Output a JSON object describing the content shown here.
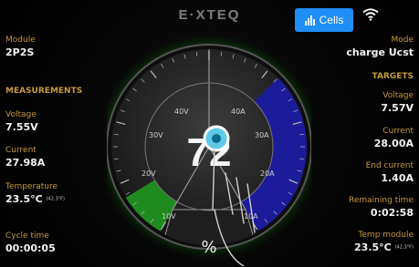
{
  "header": {
    "brand": "E·XTEQ",
    "cells_button_label": "Cells",
    "wifi_icon": "wifi-icon"
  },
  "left": {
    "module_label": "Module",
    "module_value": "2P2S",
    "measurements_label": "MEASUREMENTS",
    "voltage_label": "Voltage",
    "voltage_value": "7.55V",
    "current_label": "Current",
    "current_value": "27.98A",
    "temperature_label": "Temperature",
    "temperature_value": "23.5°C",
    "temperature_sub": "(42.3°F)",
    "cycle_label": "Cycle time",
    "cycle_value": "00:00:05"
  },
  "right": {
    "mode_label": "Mode",
    "mode_value": "charge Ucst",
    "targets_label": "TARGETS",
    "voltage_label": "Voltage",
    "voltage_value": "7.57V",
    "current_label": "Current",
    "current_value": "28.00A",
    "end_current_label": "End current",
    "end_current_value": "1.40A",
    "remaining_label": "Remaining time",
    "remaining_value": "0:02:58",
    "temp_module_label": "Temp module",
    "temp_module_value": "23.5°C",
    "temp_module_sub": "(42.3°F)"
  },
  "gauge": {
    "center_value": "72",
    "percent_label": "%",
    "voltage_ticks": [
      "10V",
      "20V",
      "30V",
      "40V"
    ],
    "current_ticks": [
      "10A",
      "20A",
      "30A",
      "40A"
    ],
    "voltage_fill": 0.19,
    "current_fill": 0.7,
    "colors": {
      "voltage": "#1f8a1f",
      "current": "#1c1c9a",
      "glow": "#3aff3a",
      "button": "#1f8ef5"
    }
  }
}
